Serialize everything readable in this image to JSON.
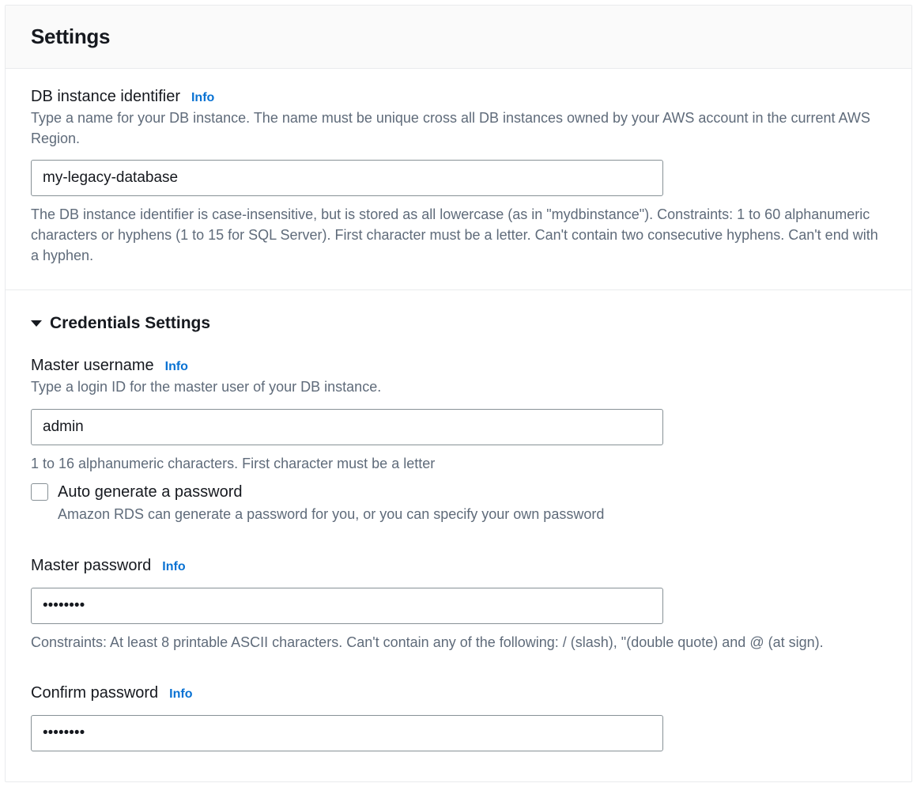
{
  "panel": {
    "title": "Settings"
  },
  "identifier": {
    "label": "DB instance identifier",
    "info": "Info",
    "description": "Type a name for your DB instance. The name must be unique cross all DB instances owned by your AWS account in the current AWS Region.",
    "value": "my-legacy-database",
    "constraint": "The DB instance identifier is case-insensitive, but is stored as all lowercase (as in \"mydbinstance\"). Constraints: 1 to 60 alphanumeric characters or hyphens (1 to 15 for SQL Server). First character must be a letter. Can't contain two consecutive hyphens. Can't end with a hyphen."
  },
  "credentials": {
    "title": "Credentials Settings",
    "username": {
      "label": "Master username",
      "info": "Info",
      "description": "Type a login ID for the master user of your DB instance.",
      "value": "admin",
      "constraint": "1 to 16 alphanumeric characters. First character must be a letter"
    },
    "autogen": {
      "label": "Auto generate a password",
      "description": "Amazon RDS can generate a password for you, or you can specify your own password"
    },
    "password": {
      "label": "Master password",
      "info": "Info",
      "value": "••••••••",
      "constraint": "Constraints: At least 8 printable ASCII characters. Can't contain any of the following: / (slash), \"(double quote) and @ (at sign)."
    },
    "confirm": {
      "label": "Confirm password",
      "info": "Info",
      "value": "••••••••"
    }
  }
}
